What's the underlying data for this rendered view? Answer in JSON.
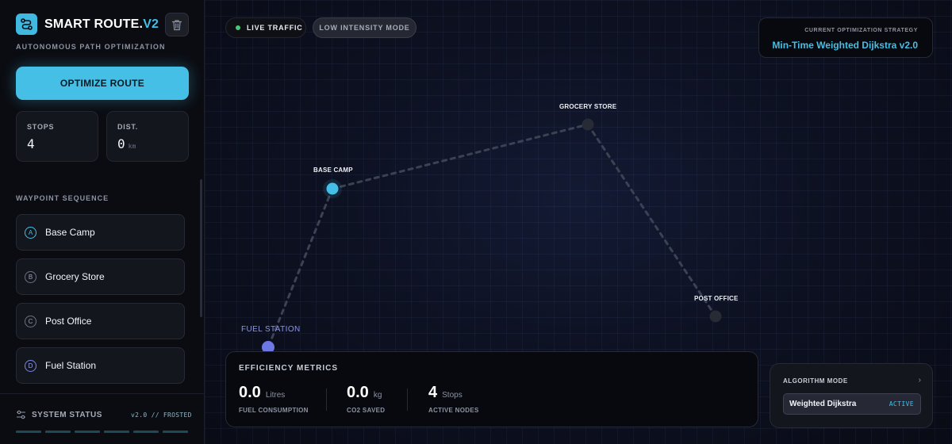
{
  "app": {
    "title_main": "SMART ROUTE.",
    "title_version": "V2",
    "subtitle": "AUTONOMOUS PATH OPTIMIZATION",
    "logo_icon": "route-icon",
    "trash_icon": "trash-icon"
  },
  "sidebar": {
    "optimize_label": "OPTIMIZE ROUTE",
    "stats": {
      "stops_label": "STOPS",
      "stops_value": "4",
      "dist_label": "DIST.",
      "dist_value": "0",
      "dist_unit": "km"
    },
    "waypoint_section": "WAYPOINT SEQUENCE",
    "waypoints": [
      {
        "letter": "A",
        "name": "Base Camp"
      },
      {
        "letter": "B",
        "name": "Grocery Store"
      },
      {
        "letter": "C",
        "name": "Post Office"
      },
      {
        "letter": "D",
        "name": "Fuel Station"
      }
    ],
    "status": {
      "label": "SYSTEM STATUS",
      "version": "v2.0 // FROSTED"
    }
  },
  "map": {
    "live_traffic": "LIVE TRAFFIC",
    "low_intensity": "LOW INTENSITY MODE",
    "strategy_caption": "CURRENT OPTIMIZATION STRATEGY",
    "strategy_name": "Min-Time Weighted Dijkstra v2.0",
    "nodes": {
      "base_camp": "BASE CAMP",
      "grocery_store": "GROCERY STORE",
      "post_office": "POST OFFICE",
      "fuel_station": "FUEL STATION"
    }
  },
  "metrics": {
    "title": "EFFICIENCY METRICS",
    "fuel": {
      "value": "0.0",
      "unit": "Litres",
      "label": "FUEL CONSUMPTION"
    },
    "co2": {
      "value": "0.0",
      "unit": "kg",
      "label": "CO2 SAVED"
    },
    "nodes": {
      "value": "4",
      "unit": "Stops",
      "label": "ACTIVE NODES"
    }
  },
  "algorithm": {
    "caption": "ALGORITHM MODE",
    "mode": "Weighted Dijkstra",
    "state": "ACTIVE"
  },
  "colors": {
    "accent": "#45bfe6",
    "fuel_node": "#7b86e8",
    "live_dot": "#48c774",
    "background": "#090a10"
  }
}
